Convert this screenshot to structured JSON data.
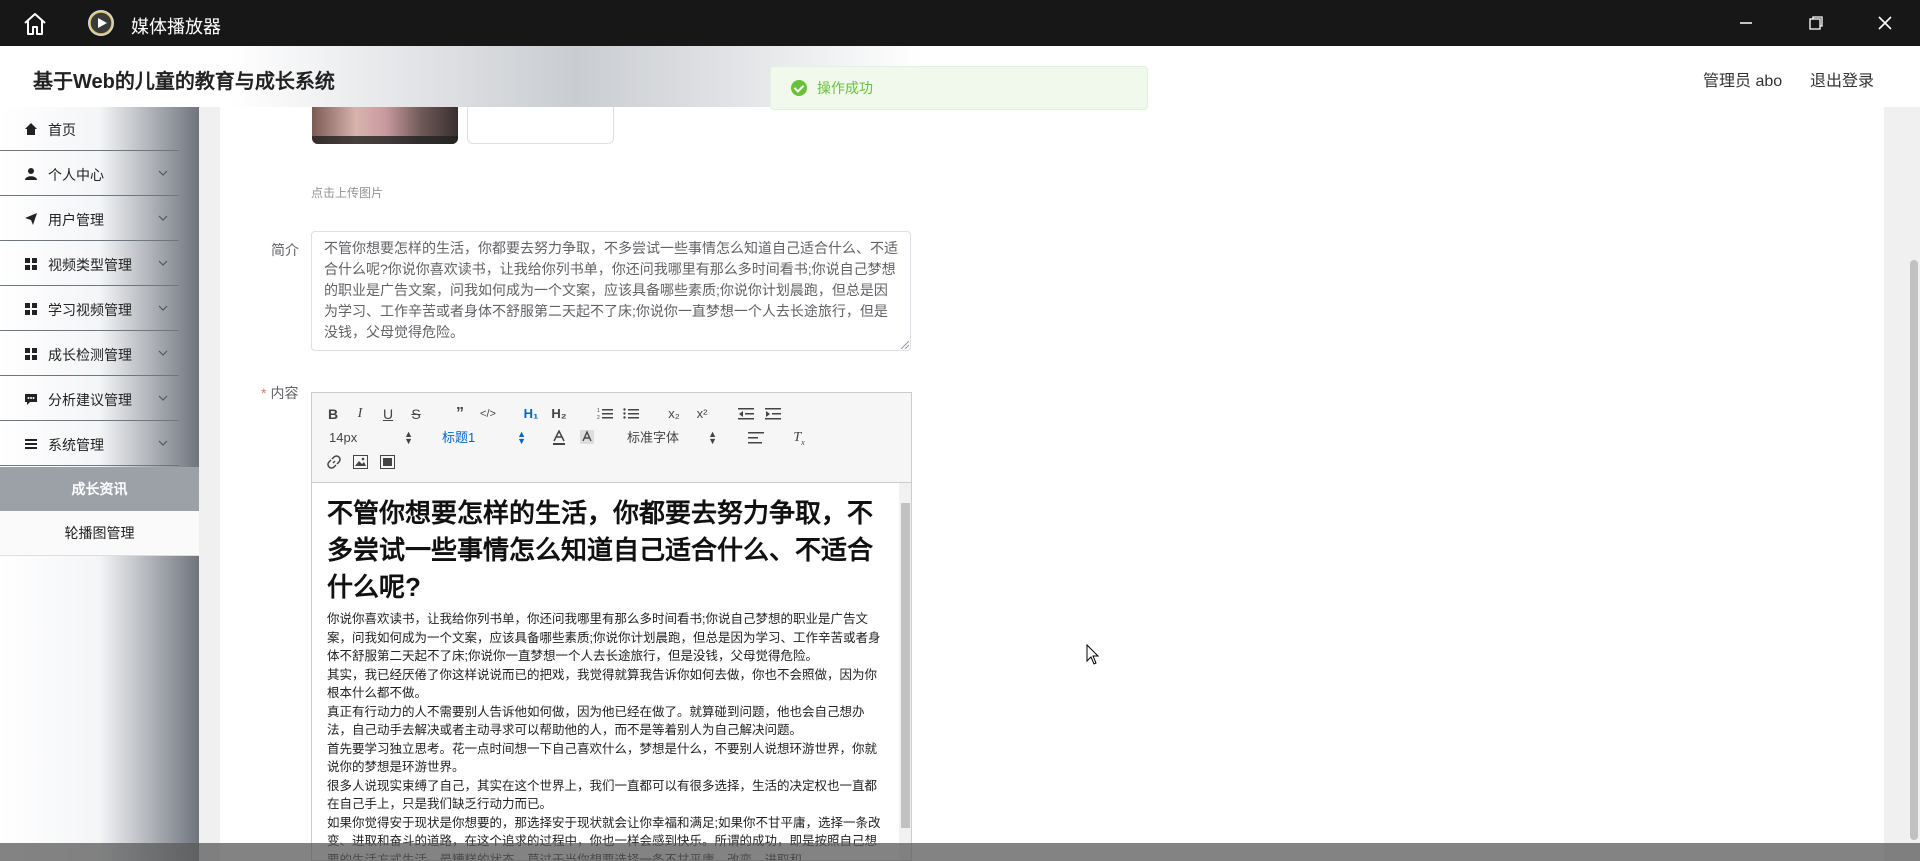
{
  "window": {
    "title": "媒体播放器"
  },
  "header": {
    "app_title": "基于Web的儿童的教育与成长系统",
    "user": "管理员 abo",
    "logout": "退出登录"
  },
  "toast": {
    "message": "操作成功",
    "color": "#67c23a"
  },
  "sidebar": {
    "items": [
      {
        "label": "首页",
        "icon": "home-icon"
      },
      {
        "label": "个人中心",
        "icon": "user-icon"
      },
      {
        "label": "用户管理",
        "icon": "paper-plane-icon"
      },
      {
        "label": "视频类型管理",
        "icon": "grid-icon"
      },
      {
        "label": "学习视频管理",
        "icon": "grid-icon"
      },
      {
        "label": "成长检测管理",
        "icon": "grid-icon"
      },
      {
        "label": "分析建议管理",
        "icon": "comment-icon"
      },
      {
        "label": "系统管理",
        "icon": "list-icon"
      }
    ],
    "subitems": [
      {
        "label": "成长资讯",
        "active": true
      },
      {
        "label": "轮播图管理",
        "active": false
      }
    ]
  },
  "form": {
    "upload_tip": "点击上传图片",
    "intro_label": "简介",
    "intro_text": "不管你想要怎样的生活，你都要去努力争取，不多尝试一些事情怎么知道自己适合什么、不适合什么呢?你说你喜欢读书，让我给你列书单，你还问我哪里有那么多时间看书;你说自己梦想的职业是广告文案，问我如何成为一个文案，应该具备哪些素质;你说你计划晨跑，但总是因为学习、工作辛苦或者身体不舒服第二天起不了床;你说你一直梦想一个人去长途旅行，但是没钱，父母觉得危险。",
    "content_label": "内容",
    "required_mark": "*"
  },
  "editor": {
    "font_size": "14px",
    "heading": "标题1",
    "font_family": "标准字体",
    "heading_color": "#2b6cc4",
    "h1": "不管你想要怎样的生活，你都要去努力争取，不多尝试一些事情怎么知道自己适合什么、不适合什么呢?",
    "paragraphs": [
      "你说你喜欢读书，让我给你列书单，你还问我哪里有那么多时间看书;你说自己梦想的职业是广告文案，问我如何成为一个文案，应该具备哪些素质;你说你计划晨跑，但总是因为学习、工作辛苦或者身体不舒服第二天起不了床;你说你一直梦想一个人去长途旅行，但是没钱，父母觉得危险。",
      "其实，我已经厌倦了你这样说说而已的把戏，我觉得就算我告诉你如何去做，你也不会照做，因为你根本什么都不做。",
      "真正有行动力的人不需要别人告诉他如何做，因为他已经在做了。就算碰到问题，他也会自己想办法，自己动手去解决或者主动寻求可以帮助他的人，而不是等着别人为自己解决问题。",
      "首先要学习独立思考。花一点时间想一下自己喜欢什么，梦想是什么，不要别人说想环游世界，你就说你的梦想是环游世界。",
      "很多人说现实束缚了自己，其实在这个世界上，我们一直都可以有很多选择，生活的决定权也一直都在自己手上，只是我们缺乏行动力而已。",
      "如果你觉得安于现状是你想要的，那选择安于现状就会让你幸福和满足;如果你不甘平庸，选择一条改变、进取和奋斗的道路，在这个追求的过程中，你也一样会感到快乐。所谓的成功，即是按照自己想要的生活方式生活。最糟糕的状态，莫过于当你想要选择一条不甘平庸、改变、进取和"
    ]
  }
}
